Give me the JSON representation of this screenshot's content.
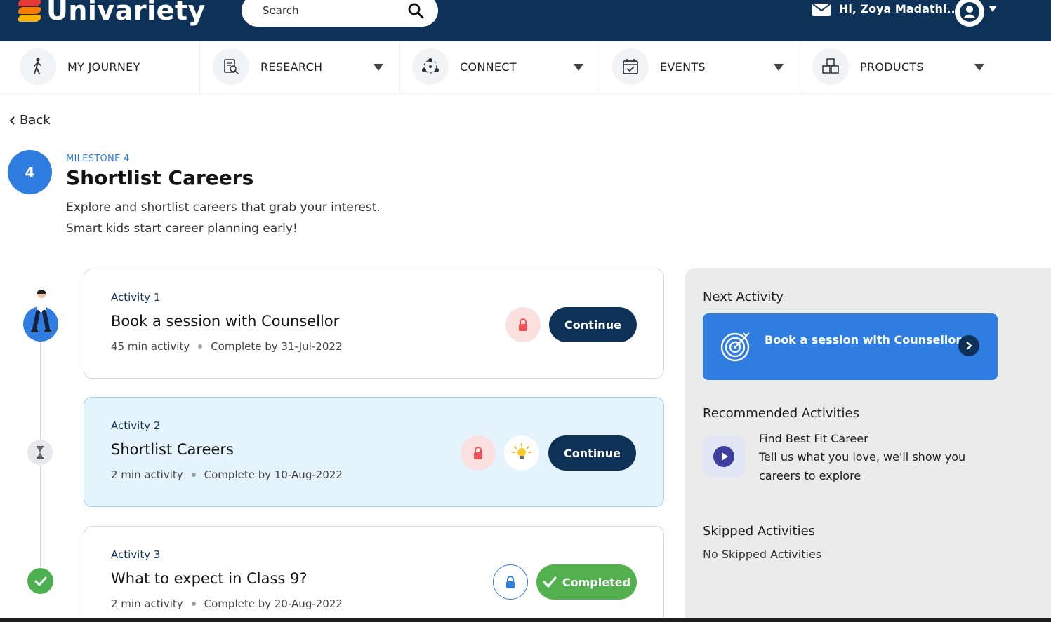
{
  "header": {
    "logo_text": "Univariety",
    "search_placeholder": "Search",
    "greeting": "Hi, Zoya Madathi..."
  },
  "nav": {
    "items": [
      {
        "label": "MY JOURNEY",
        "icon": "walking-person-icon",
        "has_dropdown": false
      },
      {
        "label": "RESEARCH",
        "icon": "document-search-icon",
        "has_dropdown": true
      },
      {
        "label": "CONNECT",
        "icon": "network-icon",
        "has_dropdown": true
      },
      {
        "label": "EVENTS",
        "icon": "calendar-check-icon",
        "has_dropdown": true
      },
      {
        "label": "PRODUCTS",
        "icon": "boxes-icon",
        "has_dropdown": true
      }
    ]
  },
  "back_label": "Back",
  "milestone": {
    "number": "4",
    "label": "MILESTONE 4",
    "title": "Shortlist Careers",
    "description_line1": "Explore and shortlist careers that grab your interest.",
    "description_line2": "Smart kids start career planning early!"
  },
  "activities": [
    {
      "label": "Activity 1",
      "title": "Book a session with Counsellor",
      "duration": "45 min activity",
      "due": "Complete by 31-Jul-2022",
      "action": "Continue",
      "status": "current"
    },
    {
      "label": "Activity 2",
      "title": "Shortlist Careers",
      "duration": "2 min activity",
      "due": "Complete by 10-Aug-2022",
      "action": "Continue",
      "status": "pending"
    },
    {
      "label": "Activity 3",
      "title": "What to expect in Class 9?",
      "duration": "2 min activity",
      "due": "Complete by 20-Aug-2022",
      "action": "Completed",
      "status": "completed"
    }
  ],
  "sidebar": {
    "next_heading": "Next Activity",
    "next_activity_title": "Book a session with Counsellor",
    "recommended_heading": "Recommended Activities",
    "recommended": {
      "title": "Find Best Fit Career",
      "desc_line1": "Tell us what you love, we'll show you",
      "desc_line2": "careers to explore"
    },
    "skipped_heading": "Skipped Activities",
    "skipped_empty": "No Skipped Activities"
  },
  "colors": {
    "header_bg": "#0e3257",
    "accent_blue": "#2f7de1",
    "completed_green": "#53b04f",
    "highlight_card": "#e5f3fc",
    "lock_red_bg": "#fbe0e0"
  }
}
